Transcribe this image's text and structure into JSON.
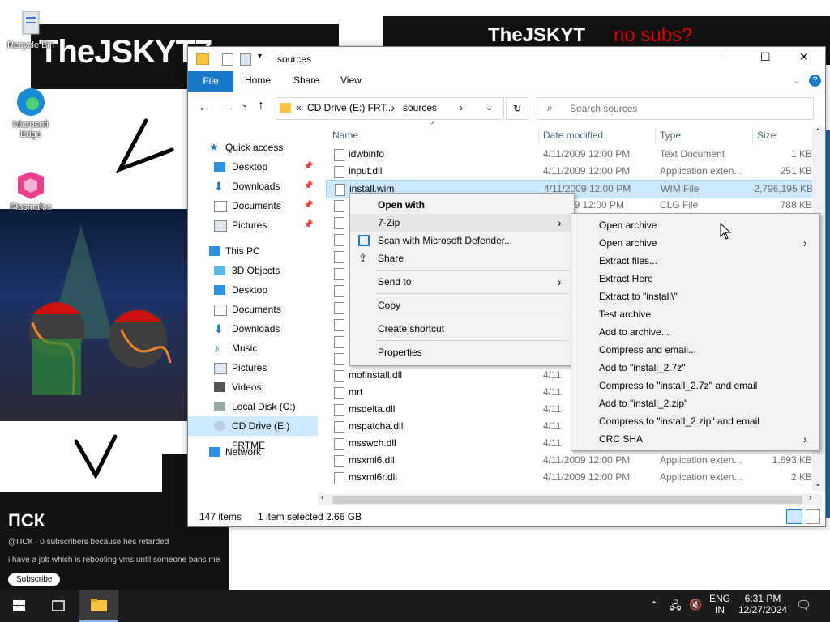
{
  "desktop": {
    "wallpaper": {
      "banner_left_text": "TheJSKYT7",
      "banner_right_text": "TheJSKYT",
      "banner_right_scrawl": "no subs?",
      "channel_name": "ПСК",
      "channel_line1": "@ПСК · 0 subscribers because hes retarded",
      "channel_line2": "i have a job which is rebooting vms until someone bans me",
      "channel_button": "Subscribe"
    },
    "icons": [
      {
        "label": "Recycle Bin",
        "icon": "recycle-bin-icon"
      },
      {
        "label": "Microsoft Edge",
        "icon": "edge-icon"
      },
      {
        "label": "Plasmafox",
        "icon": "plasmafox-icon"
      }
    ]
  },
  "window": {
    "title": "sources",
    "controls": {
      "minimize": "—",
      "maximize": "☐",
      "close": "✕"
    },
    "ribbon_tabs": [
      "File",
      "Home",
      "Share",
      "View"
    ],
    "address": {
      "prefix": "«",
      "segments": [
        "CD Drive (E:) FRT...",
        "sources"
      ]
    },
    "search_placeholder": "Search sources",
    "nav_pane": {
      "quick_access": "Quick access",
      "quick_items": [
        "Desktop",
        "Downloads",
        "Documents",
        "Pictures"
      ],
      "this_pc": "This PC",
      "pc_items": [
        "3D Objects",
        "Desktop",
        "Documents",
        "Downloads",
        "Music",
        "Pictures",
        "Videos",
        "Local Disk (C:)",
        "CD Drive (E:) FRTME"
      ],
      "network": "Network"
    },
    "columns": {
      "name": "Name",
      "date": "Date modified",
      "type": "Type",
      "size": "Size"
    },
    "files": [
      {
        "name": "idwbinfo",
        "date": "4/11/2009 12:00 PM",
        "type": "Text Document",
        "size": "1 KB"
      },
      {
        "name": "input.dll",
        "date": "4/11/2009 12:00 PM",
        "type": "Application exten...",
        "size": "251 KB"
      },
      {
        "name": "install.wim",
        "date": "4/11/2009 12:00 PM",
        "type": "WIM File",
        "size": "2,796,195 KB"
      },
      {
        "name": "",
        "date": "09 12:00 PM",
        "type": "CLG File",
        "size": "788 KB"
      },
      {
        "name": "mofinstall.dll",
        "date": "4/11",
        "type": "",
        "size": ""
      },
      {
        "name": "mrt",
        "date": "4/11",
        "type": "",
        "size": ""
      },
      {
        "name": "msdelta.dll",
        "date": "4/11",
        "type": "",
        "size": ""
      },
      {
        "name": "mspatcha.dll",
        "date": "4/11",
        "type": "",
        "size": ""
      },
      {
        "name": "msswch.dll",
        "date": "4/11",
        "type": "",
        "size": ""
      },
      {
        "name": "msxml6.dll",
        "date": "4/11/2009 12:00 PM",
        "type": "Application exten...",
        "size": "1,693 KB"
      },
      {
        "name": "msxml6r.dll",
        "date": "4/11/2009 12:00 PM",
        "type": "Application exten...",
        "size": "2 KB"
      }
    ],
    "status": {
      "count": "147 items",
      "selected": "1 item selected  2.66 GB"
    }
  },
  "context_menu": {
    "items": [
      {
        "label": "Open with",
        "bold": true
      },
      {
        "label": "7-Zip",
        "submenu": true
      },
      {
        "label": "Scan with Microsoft Defender...",
        "icon": "defender-icon"
      },
      {
        "label": "Share",
        "icon": "share-icon"
      },
      {
        "label": "Send to",
        "submenu": true
      },
      {
        "label": "Copy"
      },
      {
        "label": "Create shortcut"
      },
      {
        "label": "Properties"
      }
    ]
  },
  "zip_submenu": {
    "items": [
      "Open archive",
      "Open archive",
      "Extract files...",
      "Extract Here",
      "Extract to \"install\\\"",
      "Test archive",
      "Add to archive...",
      "Compress and email...",
      "Add to \"install_2.7z\"",
      "Compress to \"install_2.7z\" and email",
      "Add to \"install_2.zip\"",
      "Compress to \"install_2.zip\" and email",
      "CRC SHA"
    ]
  },
  "taskbar": {
    "lang_top": "ENG",
    "lang_bottom": "IN",
    "time": "6:31 PM",
    "date": "12/27/2024"
  },
  "colors": {
    "accent": "#1979ca",
    "selection": "#cce8ff",
    "taskbar": "#1c1c1c"
  }
}
